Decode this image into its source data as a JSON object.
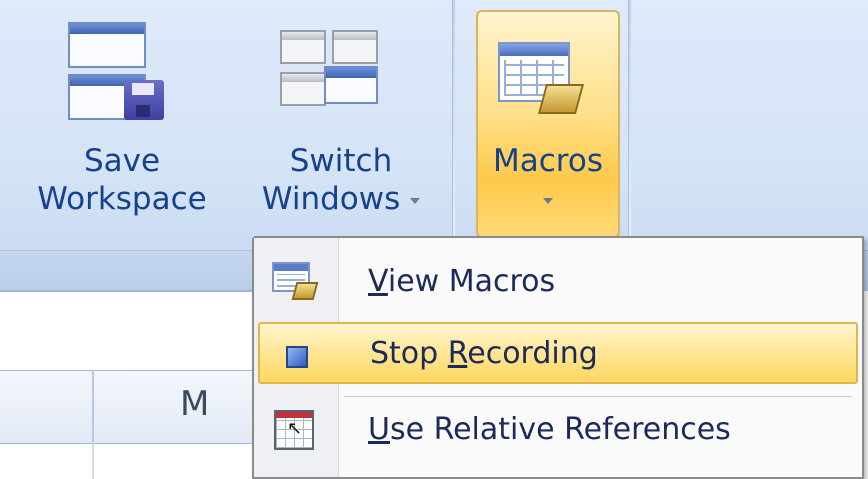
{
  "ribbon": {
    "save_workspace": {
      "line1": "Save",
      "line2": "Workspace",
      "icon": "save-workspace-icon"
    },
    "switch_windows": {
      "line1": "Switch",
      "line2": "Windows",
      "icon": "switch-windows-icon"
    },
    "macros": {
      "label": "Macros",
      "icon": "macros-icon"
    }
  },
  "menu": {
    "items": [
      {
        "pre": "",
        "accel": "V",
        "post": "iew Macros",
        "icon": "view-macros-icon"
      },
      {
        "pre": "Stop ",
        "accel": "R",
        "post": "ecording",
        "icon": "stop-recording-icon"
      },
      {
        "pre": "",
        "accel": "U",
        "post": "se Relative References",
        "icon": "relative-references-icon"
      }
    ]
  },
  "sheet": {
    "column_letter": "M"
  },
  "colors": {
    "ribbon_text": "#15428b",
    "highlight": "#ffd862",
    "menu_text": "#1b2a58"
  }
}
